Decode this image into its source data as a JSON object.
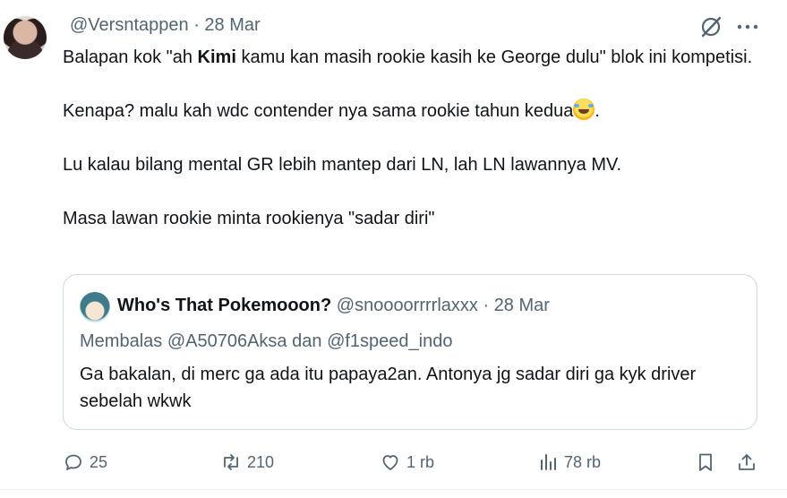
{
  "tweet": {
    "author_handle": "@Versntappen",
    "separator": "·",
    "date": "28 Mar",
    "lines": {
      "l1_before": "Balapan kok \"ah ",
      "l1_bold": "Kimi",
      "l1_after": " kamu kan masih rookie kasih ke George dulu\" blok ini kompetisi.",
      "l2_before": "Kenapa? malu kah wdc contender nya sama rookie tahun kedua",
      "l2_after": ".",
      "l3": "Lu kalau bilang mental GR lebih mantep dari LN, lah LN lawannya MV.",
      "l4": "Masa lawan rookie minta rookienya \"sadar diri\""
    },
    "emoji": "rolling-on-the-floor-laughing"
  },
  "quote": {
    "display_name": "Who's That Pokemooon?",
    "handle": "@snoooorrrrlaxxx",
    "separator": "·",
    "date": "28 Mar",
    "reply_prefix": "Membalas",
    "reply_to_1": "@A50706Aksa",
    "reply_and": "dan",
    "reply_to_2": "@f1speed_indo",
    "text": "Ga bakalan, di merc ga ada itu papaya2an. Antonya jg sadar diri ga kyk driver sebelah wkwk"
  },
  "actions": {
    "replies": "25",
    "reposts": "210",
    "likes": "1 rb",
    "views": "78 rb"
  },
  "icons": {
    "grok": "grok-icon",
    "more": "more-icon",
    "reply": "reply-icon",
    "repost": "repost-icon",
    "like": "heart-icon",
    "views": "views-icon",
    "bookmark": "bookmark-icon",
    "share": "share-icon"
  },
  "colors": {
    "text": "#0f1419",
    "muted": "#536471",
    "border": "#cfd9de"
  }
}
